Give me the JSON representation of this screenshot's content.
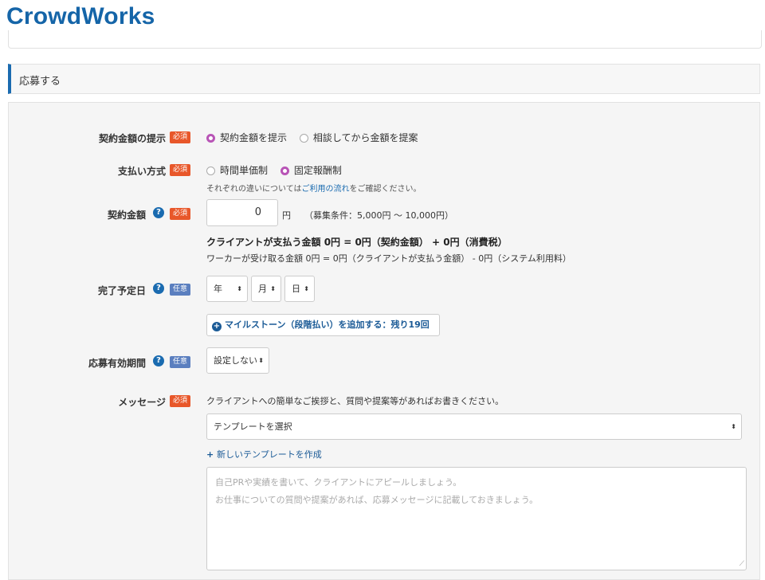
{
  "header": {
    "logo": "CrowdWorks"
  },
  "section": {
    "title": "応募する"
  },
  "badges": {
    "required": "必須",
    "optional": "任意"
  },
  "contract_proposal": {
    "label": "契約金額の提示",
    "options": [
      "契約金額を提示",
      "相談してから金額を提案"
    ],
    "selected_index": 0
  },
  "payment_method": {
    "label": "支払い方式",
    "options": [
      "時間単価制",
      "固定報酬制"
    ],
    "selected_index": 1,
    "note_pre": "それぞれの違いについては",
    "note_link": "ご利用の流れ",
    "note_post": "をご確認ください。"
  },
  "contract_amount": {
    "label": "契約金額",
    "value": "0",
    "unit": "円",
    "condition": "（募集条件：5,000円 〜 10,000円）",
    "client_pay": "クライアントが支払う金額 0円 = 0円（契約金額） + 0円（消費税）",
    "worker_receive": "ワーカーが受け取る金額 0円 = 0円（クライアントが支払う金額） - 0円（システム利用料）"
  },
  "completion_date": {
    "label": "完了予定日",
    "year": "年",
    "month": "月",
    "day": "日",
    "milestone_button": "マイルストーン（段階払い）を追加する：残り19回"
  },
  "validity": {
    "label": "応募有効期間",
    "value": "設定しない"
  },
  "message": {
    "label": "メッセージ",
    "hint": "クライアントへの簡単なご挨拶と、質問や提案等があればお書きください。",
    "template_select": "テンプレートを選択",
    "new_template": "新しいテンプレートを作成",
    "placeholder_line1": "自己PRや実績を書いて、クライアントにアピールしましょう。",
    "placeholder_line2": "お仕事についての質問や提案があれば、応募メッセージに記載しておきましょう。"
  },
  "colors": {
    "brand": "#1565a8",
    "required_badge": "#e8572a",
    "optional_badge": "#5b7fbf",
    "radio_selected": "#b854b6"
  },
  "icons": {
    "help": "question-circle-icon",
    "add": "plus-circle-icon",
    "select_arrows": "updown-chevron-icon"
  }
}
